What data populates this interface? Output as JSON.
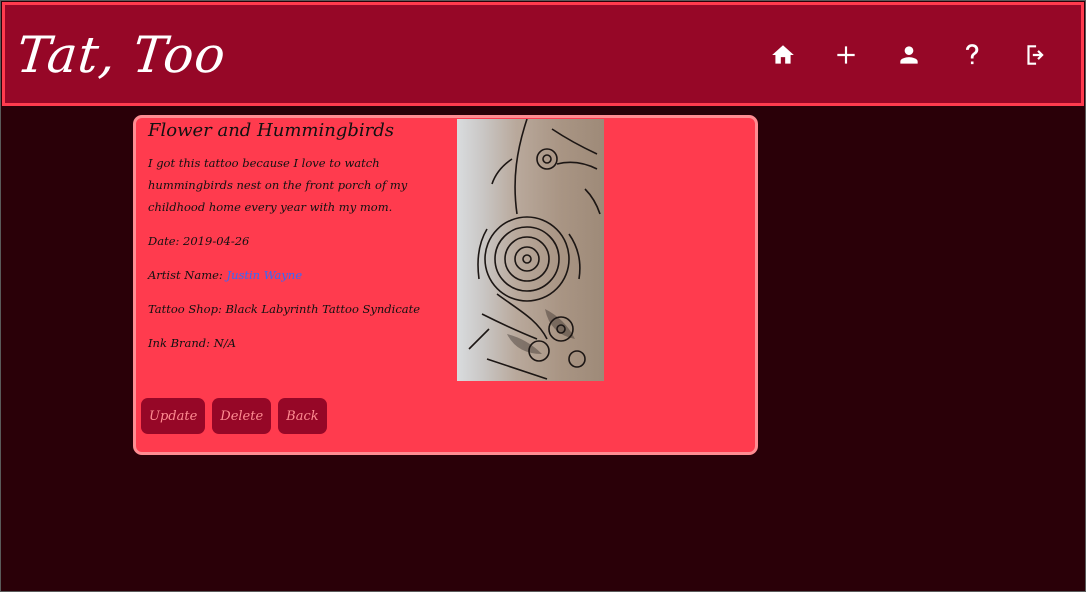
{
  "header": {
    "logo": "Tat, Too",
    "nav": [
      {
        "name": "home",
        "icon": "home-icon"
      },
      {
        "name": "add",
        "icon": "plus-icon"
      },
      {
        "name": "profile",
        "icon": "user-icon"
      },
      {
        "name": "help",
        "icon": "question-icon"
      },
      {
        "name": "logout",
        "icon": "logout-icon"
      }
    ]
  },
  "tattoo": {
    "title": "Flower and Hummingbirds",
    "description": "I got this tattoo because I love to watch hummingbirds nest on the front porch of my childhood home every year with my mom.",
    "date_label": "Date:",
    "date": "2019-04-26",
    "artist_label": "Artist Name:",
    "artist": "Justin Wayne",
    "shop_label": "Tattoo Shop:",
    "shop": "Black Labyrinth Tattoo Syndicate",
    "ink_label": "Ink Brand:",
    "ink": "N/A"
  },
  "actions": {
    "update": "Update",
    "delete": "Delete",
    "back": "Back"
  },
  "colors": {
    "background": "#2a0008",
    "header": "#960727",
    "accent": "#ff3b4e",
    "card_border": "#ff8c92",
    "link": "#2f6bff"
  }
}
